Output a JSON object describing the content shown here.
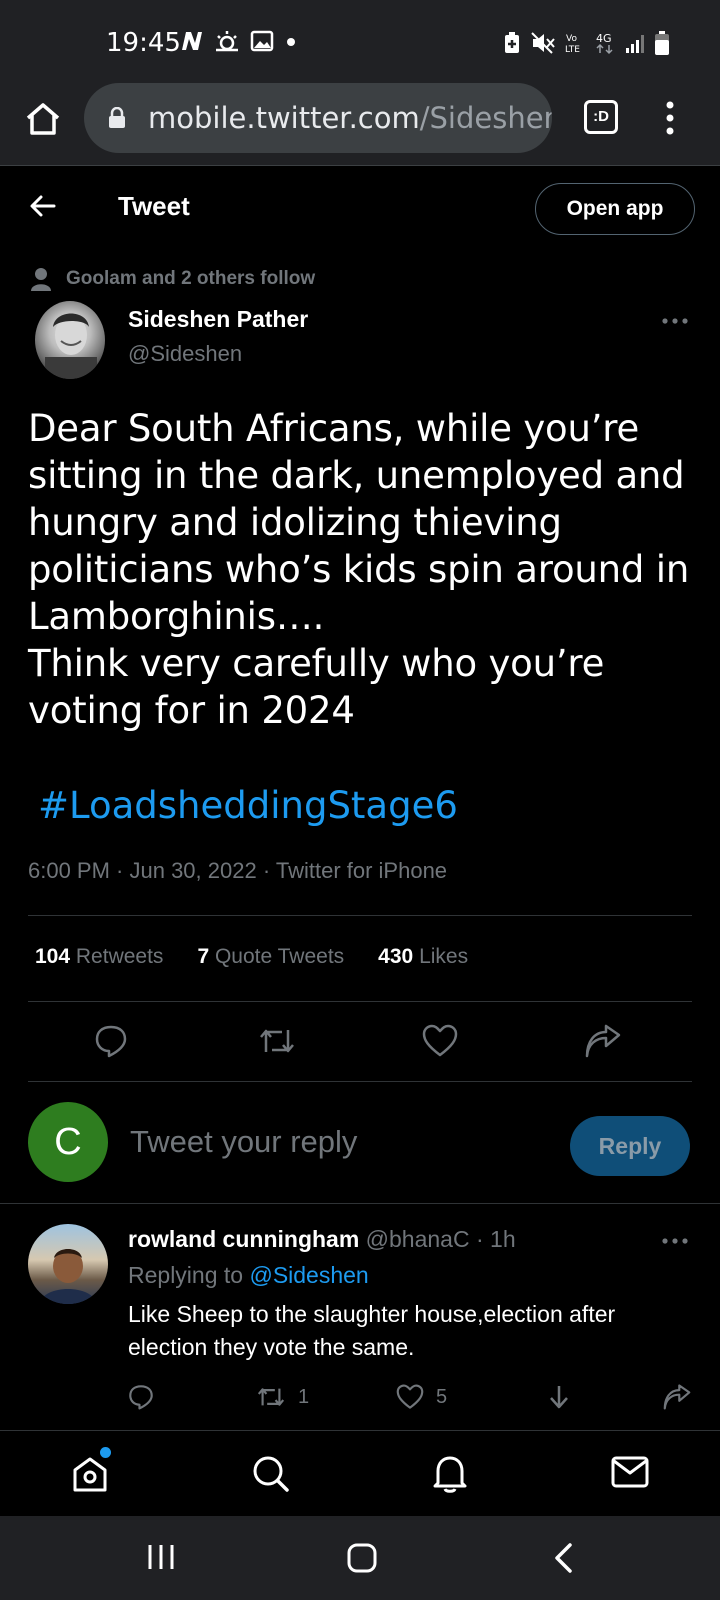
{
  "status_bar": {
    "time": "19:45",
    "icons_left": [
      "n-icon",
      "weather-icon",
      "gallery-icon",
      "dot-icon"
    ],
    "icons_right": [
      "battery-saver-icon",
      "mute-icon",
      "volte-icon",
      "4g-icon",
      "signal-icon",
      "battery-icon"
    ],
    "volte_label": "Vo LTE",
    "network_label": "4G"
  },
  "browser": {
    "url_host": "mobile.twitter.com",
    "url_path": "/Sideshen",
    "tabs_label": ":D"
  },
  "header": {
    "title": "Tweet",
    "open_app_label": "Open app"
  },
  "tweet": {
    "social_context": "Goolam and 2 others follow",
    "author_name": "Sideshen Pather",
    "author_handle": "@Sideshen",
    "text_lines": [
      "Dear South Africans, while you’re sitting in the dark, unemployed and hungry and idolizing thieving politicians who’s kids spin around in Lamborghinis….",
      "Think very carefully who you’re voting for in 2024"
    ],
    "hashtag": "#LoadsheddingStage6",
    "meta": "6:00 PM · Jun 30, 2022 · Twitter for iPhone",
    "stats": {
      "retweets_count": "104",
      "retweets_label": "Retweets",
      "quotes_count": "7",
      "quotes_label": "Quote Tweets",
      "likes_count": "430",
      "likes_label": "Likes"
    }
  },
  "composer": {
    "avatar_letter": "C",
    "avatar_color": "#2e7d1f",
    "placeholder": "Tweet your reply",
    "reply_label": "Reply"
  },
  "reply": {
    "name": "rowland cunningham",
    "handle": "@bhanaC",
    "time": "· 1h",
    "replying_prefix": "Replying to",
    "replying_to": "@Sideshen",
    "text": "Like Sheep to the slaughter house,election after election they vote the same.",
    "retweet_count": "1",
    "like_count": "5"
  },
  "colors": {
    "accent": "#1d9bf0",
    "muted": "#71767b",
    "background": "#000000",
    "chrome": "#202124"
  }
}
